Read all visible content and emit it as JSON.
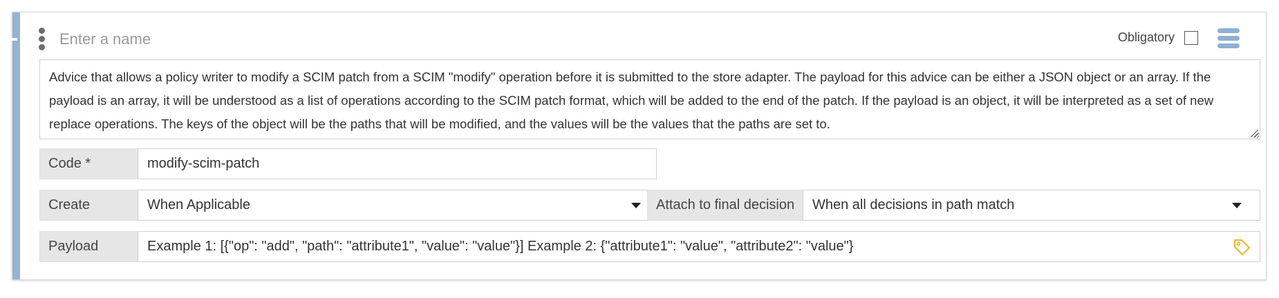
{
  "header": {
    "name_placeholder": "Enter a name",
    "name_value": "",
    "obligatory_label": "Obligatory",
    "obligatory_checked": false
  },
  "description": "Advice that allows a policy writer to modify a SCIM patch from a SCIM \"modify\" operation before it is submitted to the store adapter. The payload for this advice can be either a JSON object or an array. If the payload is an array, it will be understood as a list of operations according to the SCIM patch format, which will be added to the end of the patch. If the payload is an object, it will be interpreted as a set of new replace operations. The keys of the object will be the paths that will be modified, and the values will be the values that the paths are set to.",
  "code": {
    "label": "Code *",
    "value": "modify-scim-patch"
  },
  "create": {
    "label": "Create",
    "value": "When Applicable"
  },
  "attach": {
    "label": "Attach to final decision",
    "value": "When all decisions in path match"
  },
  "payload": {
    "label": "Payload",
    "value": "Example 1: [{\"op\": \"add\", \"path\": \"attribute1\", \"value\": \"value\"}] Example 2: {\"attribute1\": \"value\", \"attribute2\": \"value\"}"
  },
  "icons": {
    "drag": "drag-handle-icon",
    "menu": "hamburger-menu-icon",
    "tag": "tag-icon",
    "dropdown": "chevron-down-icon"
  },
  "colors": {
    "accent_bar": "#95b3d3",
    "menu_icon": "#8fb0d2",
    "tag_icon": "#f0b429",
    "label_background": "#e6e6e6"
  }
}
